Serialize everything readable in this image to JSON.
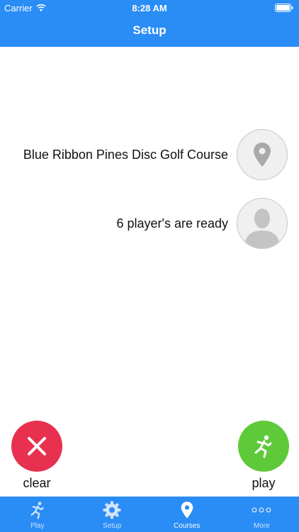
{
  "status_bar": {
    "carrier": "Carrier",
    "time": "8:28 AM"
  },
  "nav": {
    "title": "Setup"
  },
  "course": {
    "label": "Blue Ribbon Pines Disc Golf Course",
    "icon": "location-pin-icon"
  },
  "players": {
    "label": "6 player's are ready",
    "icon": "person-silhouette-icon"
  },
  "actions": {
    "clear": {
      "label": "clear",
      "color": "#e8304f",
      "icon": "x-icon"
    },
    "play": {
      "label": "play",
      "color": "#5ec939",
      "icon": "runner-icon"
    }
  },
  "tabs": [
    {
      "label": "Play",
      "icon": "runner-icon",
      "active": false
    },
    {
      "label": "Setup",
      "icon": "gear-icon",
      "active": false
    },
    {
      "label": "Courses",
      "icon": "location-pin-icon",
      "active": true
    },
    {
      "label": "More",
      "icon": "more-dots-icon",
      "active": false
    }
  ],
  "colors": {
    "brand": "#2a8cf5",
    "inactive_tab": "#cfe3fb"
  }
}
